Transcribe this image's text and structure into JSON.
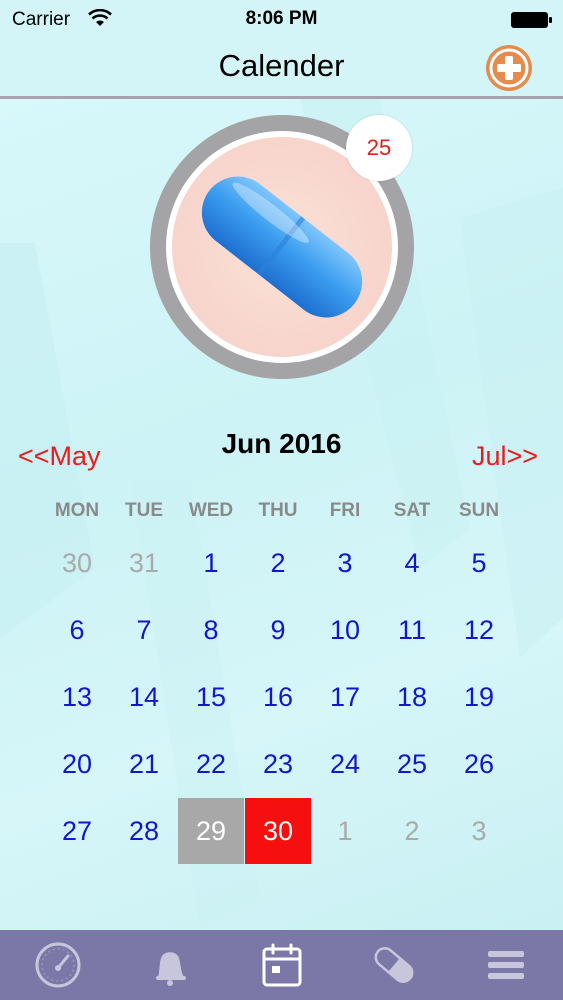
{
  "status_bar": {
    "carrier": "Carrier",
    "time": "8:06 PM",
    "icons": [
      "wifi-icon",
      "battery-icon"
    ]
  },
  "nav": {
    "title": "Calender",
    "add_icon": "plus-circle-icon"
  },
  "pill": {
    "icon": "pill-capsule-icon",
    "count": "25"
  },
  "calendar": {
    "month_title": "Jun 2016",
    "prev_label": "<<May",
    "next_label": "Jul>>",
    "weekdays": [
      "MON",
      "TUE",
      "WED",
      "THU",
      "FRI",
      "SAT",
      "SUN"
    ],
    "days": [
      {
        "label": "30",
        "state": "out"
      },
      {
        "label": "31",
        "state": "out"
      },
      {
        "label": "1",
        "state": "in"
      },
      {
        "label": "2",
        "state": "in"
      },
      {
        "label": "3",
        "state": "in"
      },
      {
        "label": "4",
        "state": "in"
      },
      {
        "label": "5",
        "state": "in"
      },
      {
        "label": "6",
        "state": "in"
      },
      {
        "label": "7",
        "state": "in"
      },
      {
        "label": "8",
        "state": "in"
      },
      {
        "label": "9",
        "state": "in"
      },
      {
        "label": "10",
        "state": "in"
      },
      {
        "label": "11",
        "state": "in"
      },
      {
        "label": "12",
        "state": "in"
      },
      {
        "label": "13",
        "state": "in"
      },
      {
        "label": "14",
        "state": "in"
      },
      {
        "label": "15",
        "state": "in"
      },
      {
        "label": "16",
        "state": "in"
      },
      {
        "label": "17",
        "state": "in"
      },
      {
        "label": "18",
        "state": "in"
      },
      {
        "label": "19",
        "state": "in"
      },
      {
        "label": "20",
        "state": "in"
      },
      {
        "label": "21",
        "state": "in"
      },
      {
        "label": "22",
        "state": "in"
      },
      {
        "label": "23",
        "state": "in"
      },
      {
        "label": "24",
        "state": "in"
      },
      {
        "label": "25",
        "state": "in"
      },
      {
        "label": "26",
        "state": "in"
      },
      {
        "label": "27",
        "state": "in"
      },
      {
        "label": "28",
        "state": "in"
      },
      {
        "label": "29",
        "state": "yesterday"
      },
      {
        "label": "30",
        "state": "today"
      },
      {
        "label": "1",
        "state": "out"
      },
      {
        "label": "2",
        "state": "out"
      },
      {
        "label": "3",
        "state": "out"
      }
    ]
  },
  "tab_bar": {
    "tabs": [
      {
        "icon": "speedometer-icon",
        "selected": false
      },
      {
        "icon": "bell-icon",
        "selected": false
      },
      {
        "icon": "calendar-icon",
        "selected": true
      },
      {
        "icon": "pill-icon",
        "selected": false
      },
      {
        "icon": "menu-icon",
        "selected": false
      }
    ]
  },
  "colors": {
    "background": "#d4f5f7",
    "accent_red": "#ea1b1b",
    "day_blue": "#1515c9",
    "tab_bar": "#7b78a8",
    "add_button": "#e58b4c"
  }
}
